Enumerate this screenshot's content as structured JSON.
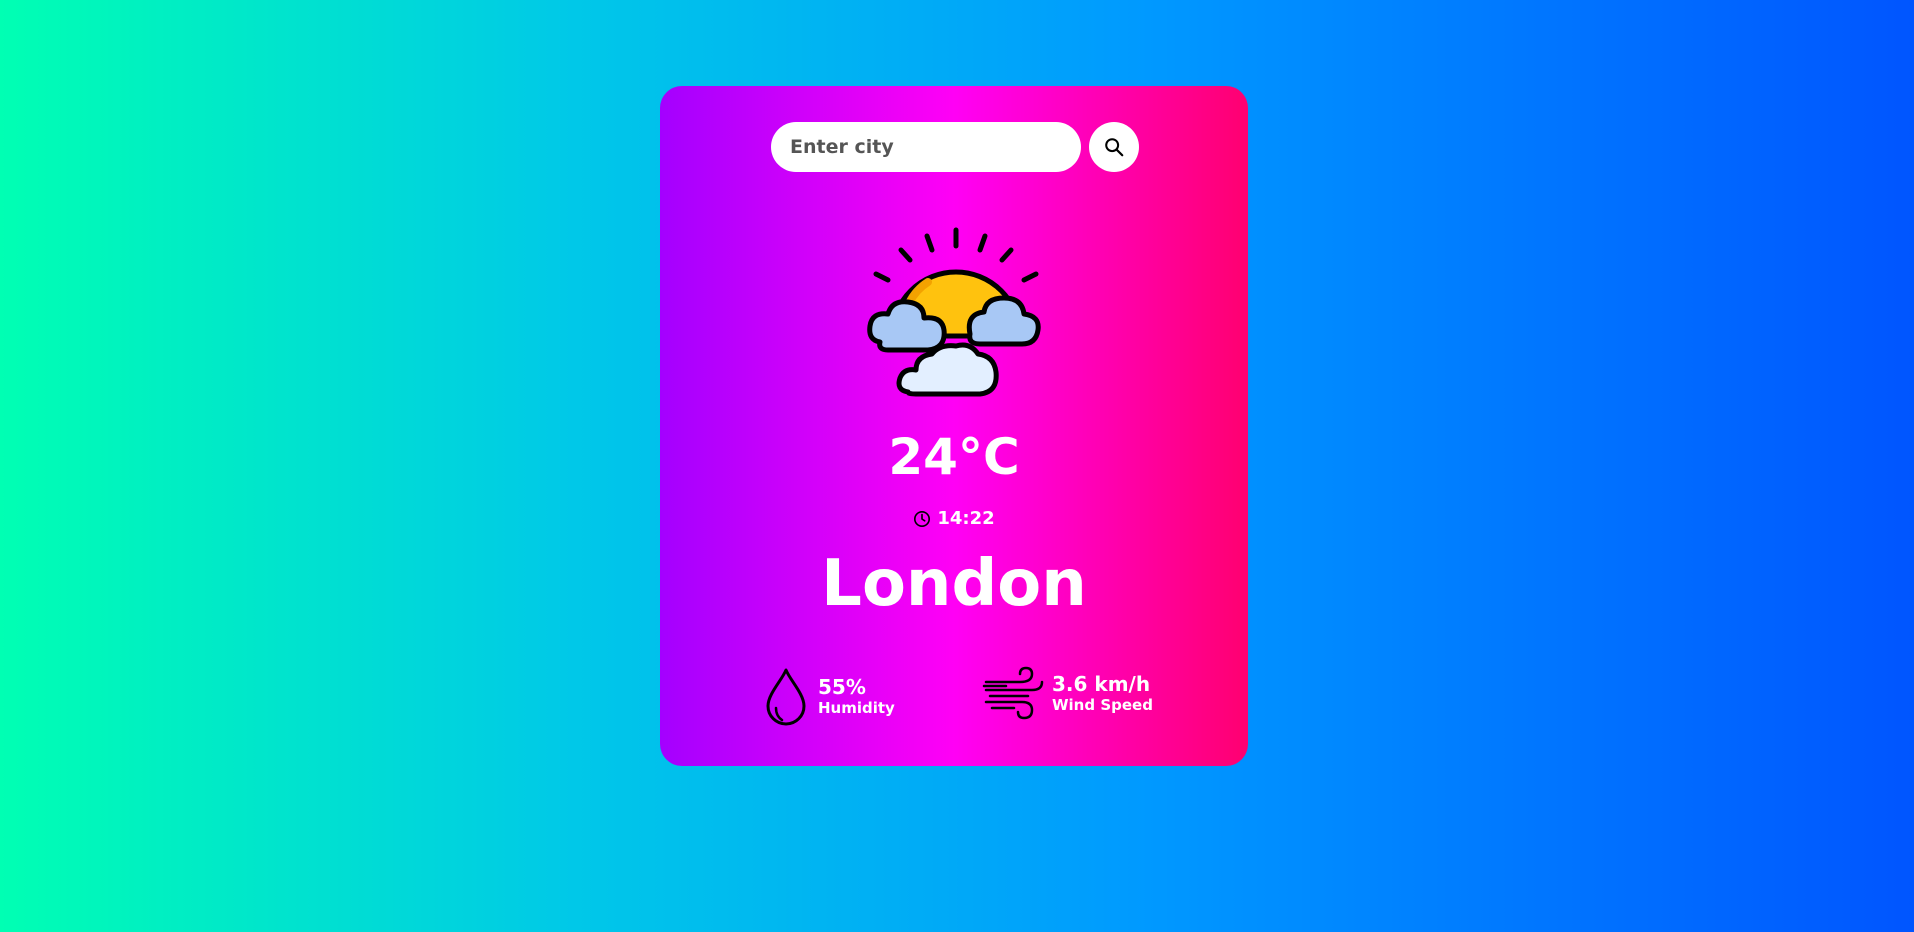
{
  "search": {
    "placeholder": "Enter city",
    "value": ""
  },
  "weather": {
    "icon": "partly-cloudy-sun-icon",
    "temperature": "24°C",
    "time": "14:22",
    "city": "London"
  },
  "stats": {
    "humidity": {
      "value": "55%",
      "label": "Humidity",
      "icon": "water-drop-icon"
    },
    "wind": {
      "value": "3.6 km/h",
      "label": "Wind Speed",
      "icon": "wind-icon"
    }
  },
  "colors": {
    "background_start": "#00ffb3",
    "background_end": "#0055ff",
    "card_start": "#a400ff",
    "card_mid": "#ff00f5",
    "card_end": "#ff0070",
    "sun": "#ffc20e",
    "cloud": "#a8c8f5"
  }
}
